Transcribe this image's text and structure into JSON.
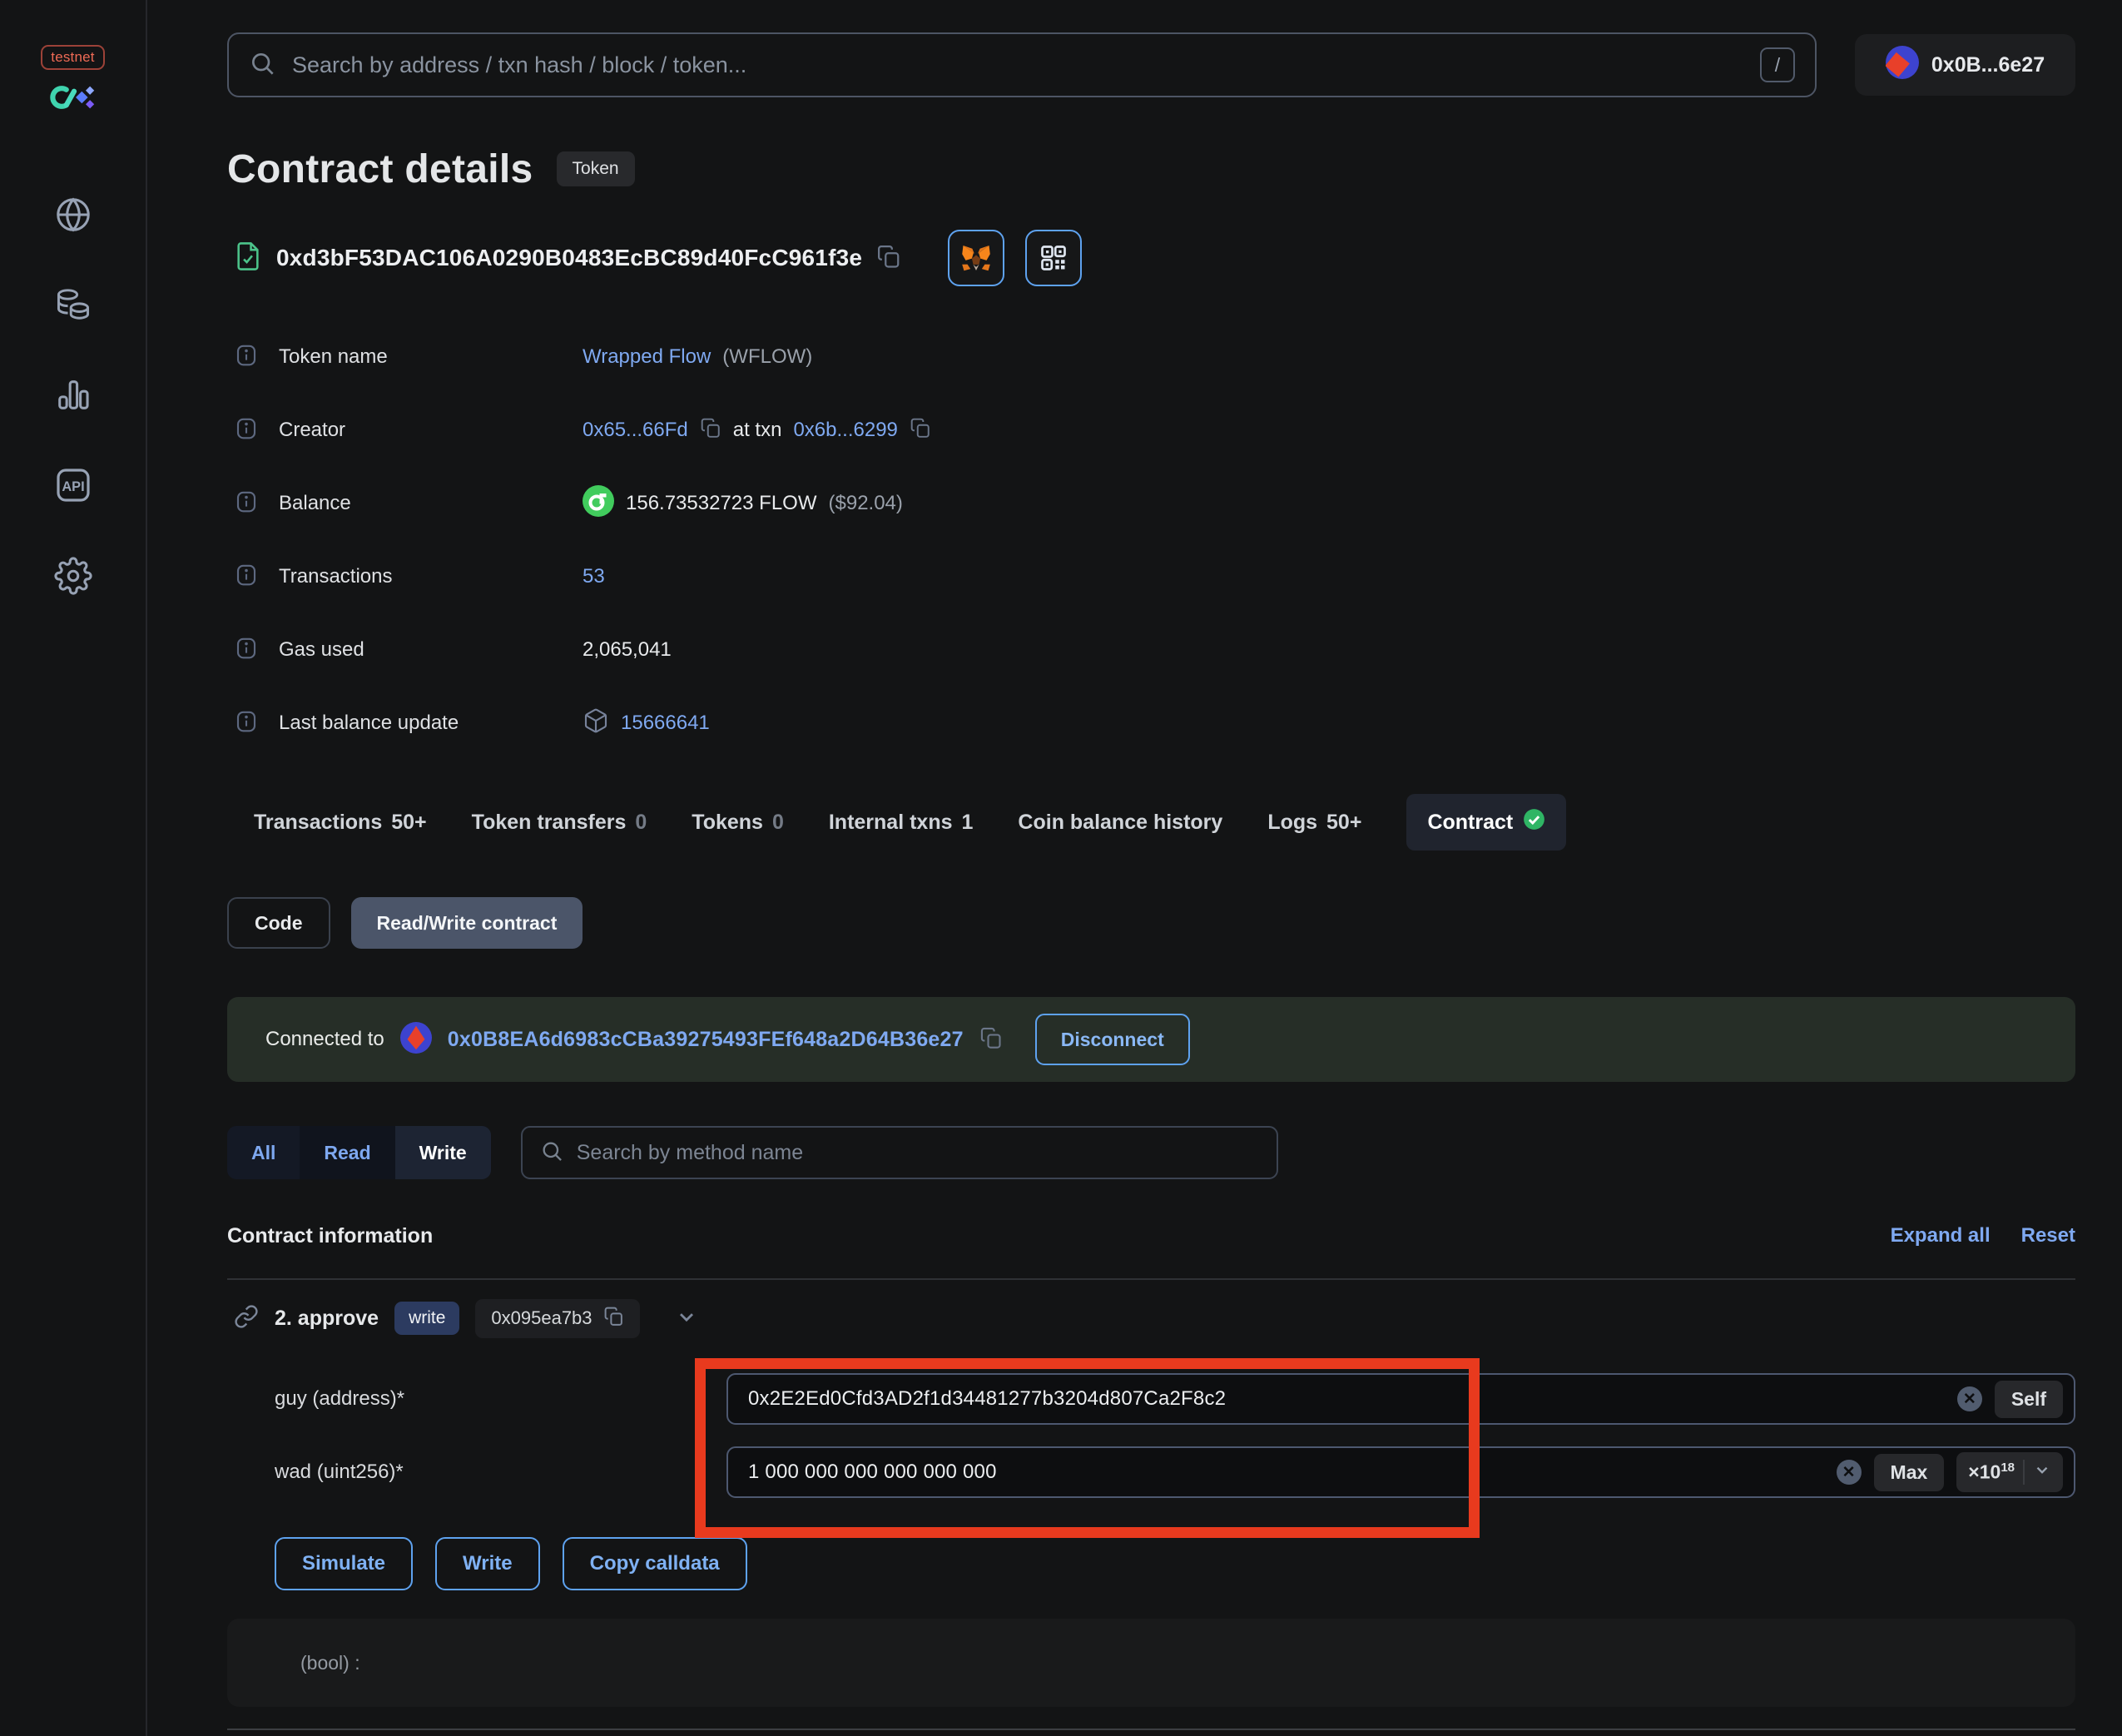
{
  "app": {
    "network_badge": "testnet",
    "account_label": "0x0B...6e27"
  },
  "search": {
    "placeholder": "Search by address / txn hash / block / token...",
    "shortcut": "/"
  },
  "sidebar": {
    "icons": [
      "globe-icon",
      "tokens-icon",
      "stats-icon",
      "api-icon",
      "settings-icon"
    ]
  },
  "header": {
    "title": "Contract details",
    "badge": "Token"
  },
  "address": {
    "hash": "0xd3bF53DAC106A0290B0483EcBC89d40FcC961f3e"
  },
  "info": {
    "rows": [
      {
        "label": "Token name",
        "link": "Wrapped Flow",
        "suffix": "(WFLOW)"
      },
      {
        "label": "Creator",
        "link1": "0x65...66Fd",
        "mid": "at txn",
        "link2": "0x6b...6299"
      },
      {
        "label": "Balance",
        "value": "156.73532723 FLOW",
        "suffix": "($92.04)"
      },
      {
        "label": "Transactions",
        "link": "53"
      },
      {
        "label": "Gas used",
        "value": "2,065,041"
      },
      {
        "label": "Last balance update",
        "link": "15666641"
      }
    ]
  },
  "tabs": {
    "items": [
      {
        "label": "Transactions",
        "count": "50+"
      },
      {
        "label": "Token transfers",
        "count": "0"
      },
      {
        "label": "Tokens",
        "count": "0"
      },
      {
        "label": "Internal txns",
        "count": "1"
      },
      {
        "label": "Coin balance history",
        "count": ""
      },
      {
        "label": "Logs",
        "count": "50+"
      }
    ],
    "contract_tab": "Contract"
  },
  "subtabs": {
    "code": "Code",
    "readwrite": "Read/Write contract"
  },
  "connection": {
    "prefix": "Connected to",
    "address": "0x0B8EA6d6983cCBa39275493FEf648a2D64B36e27",
    "disconnect": "Disconnect"
  },
  "filter": {
    "all": "All",
    "read": "Read",
    "write": "Write",
    "search_placeholder": "Search by method name"
  },
  "section": {
    "title": "Contract information",
    "expand_all": "Expand all",
    "reset": "Reset"
  },
  "method": {
    "name": "2. approve",
    "type_badge": "write",
    "selector": "0x095ea7b3",
    "fields": [
      {
        "label": "guy (address)*",
        "value": "0x2E2Ed0Cfd3AD2f1d34481277b3204d807Ca2F8c2",
        "action": "Self"
      },
      {
        "label": "wad (uint256)*",
        "value": "1 000 000 000 000 000 000",
        "action": "Max",
        "multiplier": "×10",
        "exponent": "18"
      }
    ],
    "buttons": {
      "simulate": "Simulate",
      "write": "Write",
      "copy_calldata": "Copy calldata"
    },
    "output": "(bool) :"
  },
  "colors": {
    "accent_blue": "#7fa9f1",
    "button_border_blue": "#5ea2ef",
    "annotation_red": "#e83a1e",
    "success_green": "#2fb565",
    "flow_green": "#41cc5d",
    "banner_green_bg": "#262e27"
  }
}
